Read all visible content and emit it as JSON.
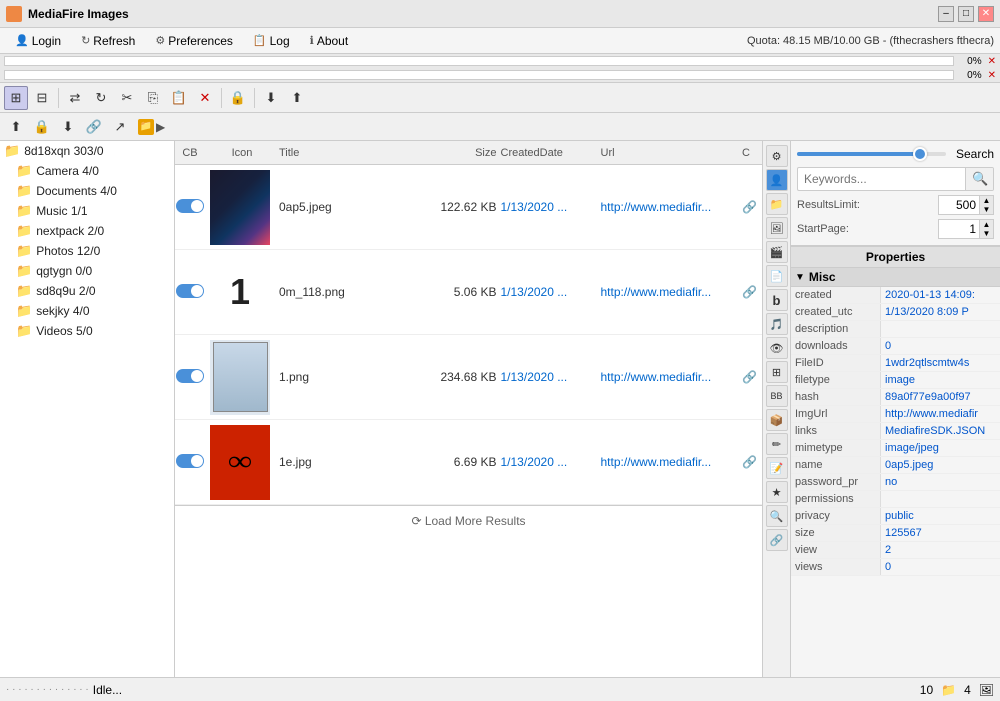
{
  "titlebar": {
    "title": "MediaFire Images",
    "controls": [
      "minimize",
      "restore",
      "close"
    ]
  },
  "menubar": {
    "items": [
      {
        "label": "Login",
        "icon": "👤"
      },
      {
        "label": "Refresh",
        "icon": "↻"
      },
      {
        "label": "Preferences",
        "icon": "⚙"
      },
      {
        "label": "Log",
        "icon": "📋"
      },
      {
        "label": "About",
        "icon": "ℹ"
      }
    ],
    "quota": "Quota: 48.15 MB/10.00 GB - (fthecrashers fthecra)"
  },
  "progressbars": [
    {
      "label": "0%"
    },
    {
      "label": "0%"
    }
  ],
  "sidebar": {
    "items": [
      {
        "label": "8d18xqn 303/0",
        "indent": 0
      },
      {
        "label": "Camera 4/0",
        "indent": 1
      },
      {
        "label": "Documents 4/0",
        "indent": 1
      },
      {
        "label": "Music 1/1",
        "indent": 1
      },
      {
        "label": "nextpack 2/0",
        "indent": 1
      },
      {
        "label": "Photos 12/0",
        "indent": 1
      },
      {
        "label": "qgtygn 0/0",
        "indent": 1
      },
      {
        "label": "sd8q9u 2/0",
        "indent": 1
      },
      {
        "label": "sekjky 4/0",
        "indent": 1
      },
      {
        "label": "Videos 5/0",
        "indent": 1
      }
    ]
  },
  "filelist": {
    "headers": [
      "CB",
      "Icon",
      "Title",
      "Size",
      "CreatedDate",
      "Url",
      "C"
    ],
    "rows": [
      {
        "title": "0ap5.jpeg",
        "size": "122.62 KB",
        "date": "1/13/2020 ...",
        "url": "http://www.mediafir...",
        "type": "0ap5"
      },
      {
        "title": "0m_118.png",
        "size": "5.06 KB",
        "date": "1/13/2020 ...",
        "url": "http://www.mediafir...",
        "type": "0m118"
      },
      {
        "title": "1.png",
        "size": "234.68 KB",
        "date": "1/13/2020 ...",
        "url": "http://www.mediafir...",
        "type": "1png"
      },
      {
        "title": "1e.jpg",
        "size": "6.69 KB",
        "date": "1/13/2020 ...",
        "url": "http://www.mediafir...",
        "type": "1e"
      }
    ],
    "load_more": "⟳ Load More Results"
  },
  "search": {
    "placeholder": "Keywords...",
    "results_limit_label": "ResultsLimit:",
    "results_limit_value": "500",
    "start_page_label": "StartPage:",
    "start_page_value": "1",
    "search_label": "Search"
  },
  "properties": {
    "title": "Properties",
    "section": "Misc",
    "rows": [
      {
        "key": "created",
        "value": "2020-01-13 14:09:"
      },
      {
        "key": "created_utc",
        "value": "1/13/2020 8:09 P"
      },
      {
        "key": "description",
        "value": ""
      },
      {
        "key": "downloads",
        "value": "0"
      },
      {
        "key": "FileID",
        "value": "1wdr2qtlscmtw4s"
      },
      {
        "key": "filetype",
        "value": "image"
      },
      {
        "key": "hash",
        "value": "89a0f77e9a00f97"
      },
      {
        "key": "ImgUrl",
        "value": "http://www.mediafir"
      },
      {
        "key": "links",
        "value": "MediafireSDK.JSON"
      },
      {
        "key": "mimetype",
        "value": "image/jpeg"
      },
      {
        "key": "name",
        "value": "0ap5.jpeg"
      },
      {
        "key": "password_pr",
        "value": "no"
      },
      {
        "key": "permissions",
        "value": ""
      },
      {
        "key": "privacy",
        "value": "public"
      },
      {
        "key": "size",
        "value": "125567"
      },
      {
        "key": "view",
        "value": "2"
      },
      {
        "key": "views",
        "value": "0"
      }
    ]
  },
  "statusbar": {
    "status_text": "Idle...",
    "count1": "10",
    "count2": "4"
  }
}
